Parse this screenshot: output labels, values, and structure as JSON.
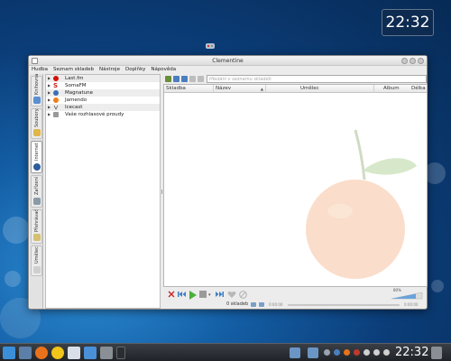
{
  "desktop": {
    "clock": "22:32"
  },
  "window": {
    "title": "Clementine",
    "menu": [
      "Hudba",
      "Seznam skladeb",
      "Nástroje",
      "Doplňky",
      "Nápověda"
    ]
  },
  "side_tabs": [
    {
      "label": "Knihovna",
      "icon": "library-icon"
    },
    {
      "label": "Soubory",
      "icon": "folder-icon"
    },
    {
      "label": "Internet",
      "icon": "globe-icon",
      "active": true
    },
    {
      "label": "Zařízení",
      "icon": "device-icon"
    },
    {
      "label": "Přehrávač",
      "icon": "playlist-icon"
    },
    {
      "label": "Umělec",
      "icon": "artist-icon"
    }
  ],
  "internet_services": [
    {
      "label": "Last.fm",
      "icon": "lastfm-icon",
      "color": "#d51007"
    },
    {
      "label": "SomaFM",
      "icon": "somafm-icon",
      "color": "#cc2222"
    },
    {
      "label": "Magnatune",
      "icon": "magnatune-icon",
      "color": "#3b6fb6"
    },
    {
      "label": "Jamendo",
      "icon": "jamendo-icon",
      "color": "#f07e1a"
    },
    {
      "label": "Icecast",
      "icon": "icecast-icon",
      "color": "#555555"
    },
    {
      "label": "Vaše rozhlasové proudy",
      "icon": "radio-icon",
      "color": "#777777"
    }
  ],
  "playlist": {
    "filter_placeholder": "Hledání v seznamu skladeb",
    "columns": [
      "Skladba",
      "Název",
      "Umělec",
      "Album",
      "Délka"
    ],
    "status": "0 skladeb",
    "time_elapsed": "0:00:00",
    "time_total": "0:00:00",
    "volume": "80%"
  },
  "colors": {
    "accent": "#3b8fd9",
    "play": "#4caf3a"
  }
}
